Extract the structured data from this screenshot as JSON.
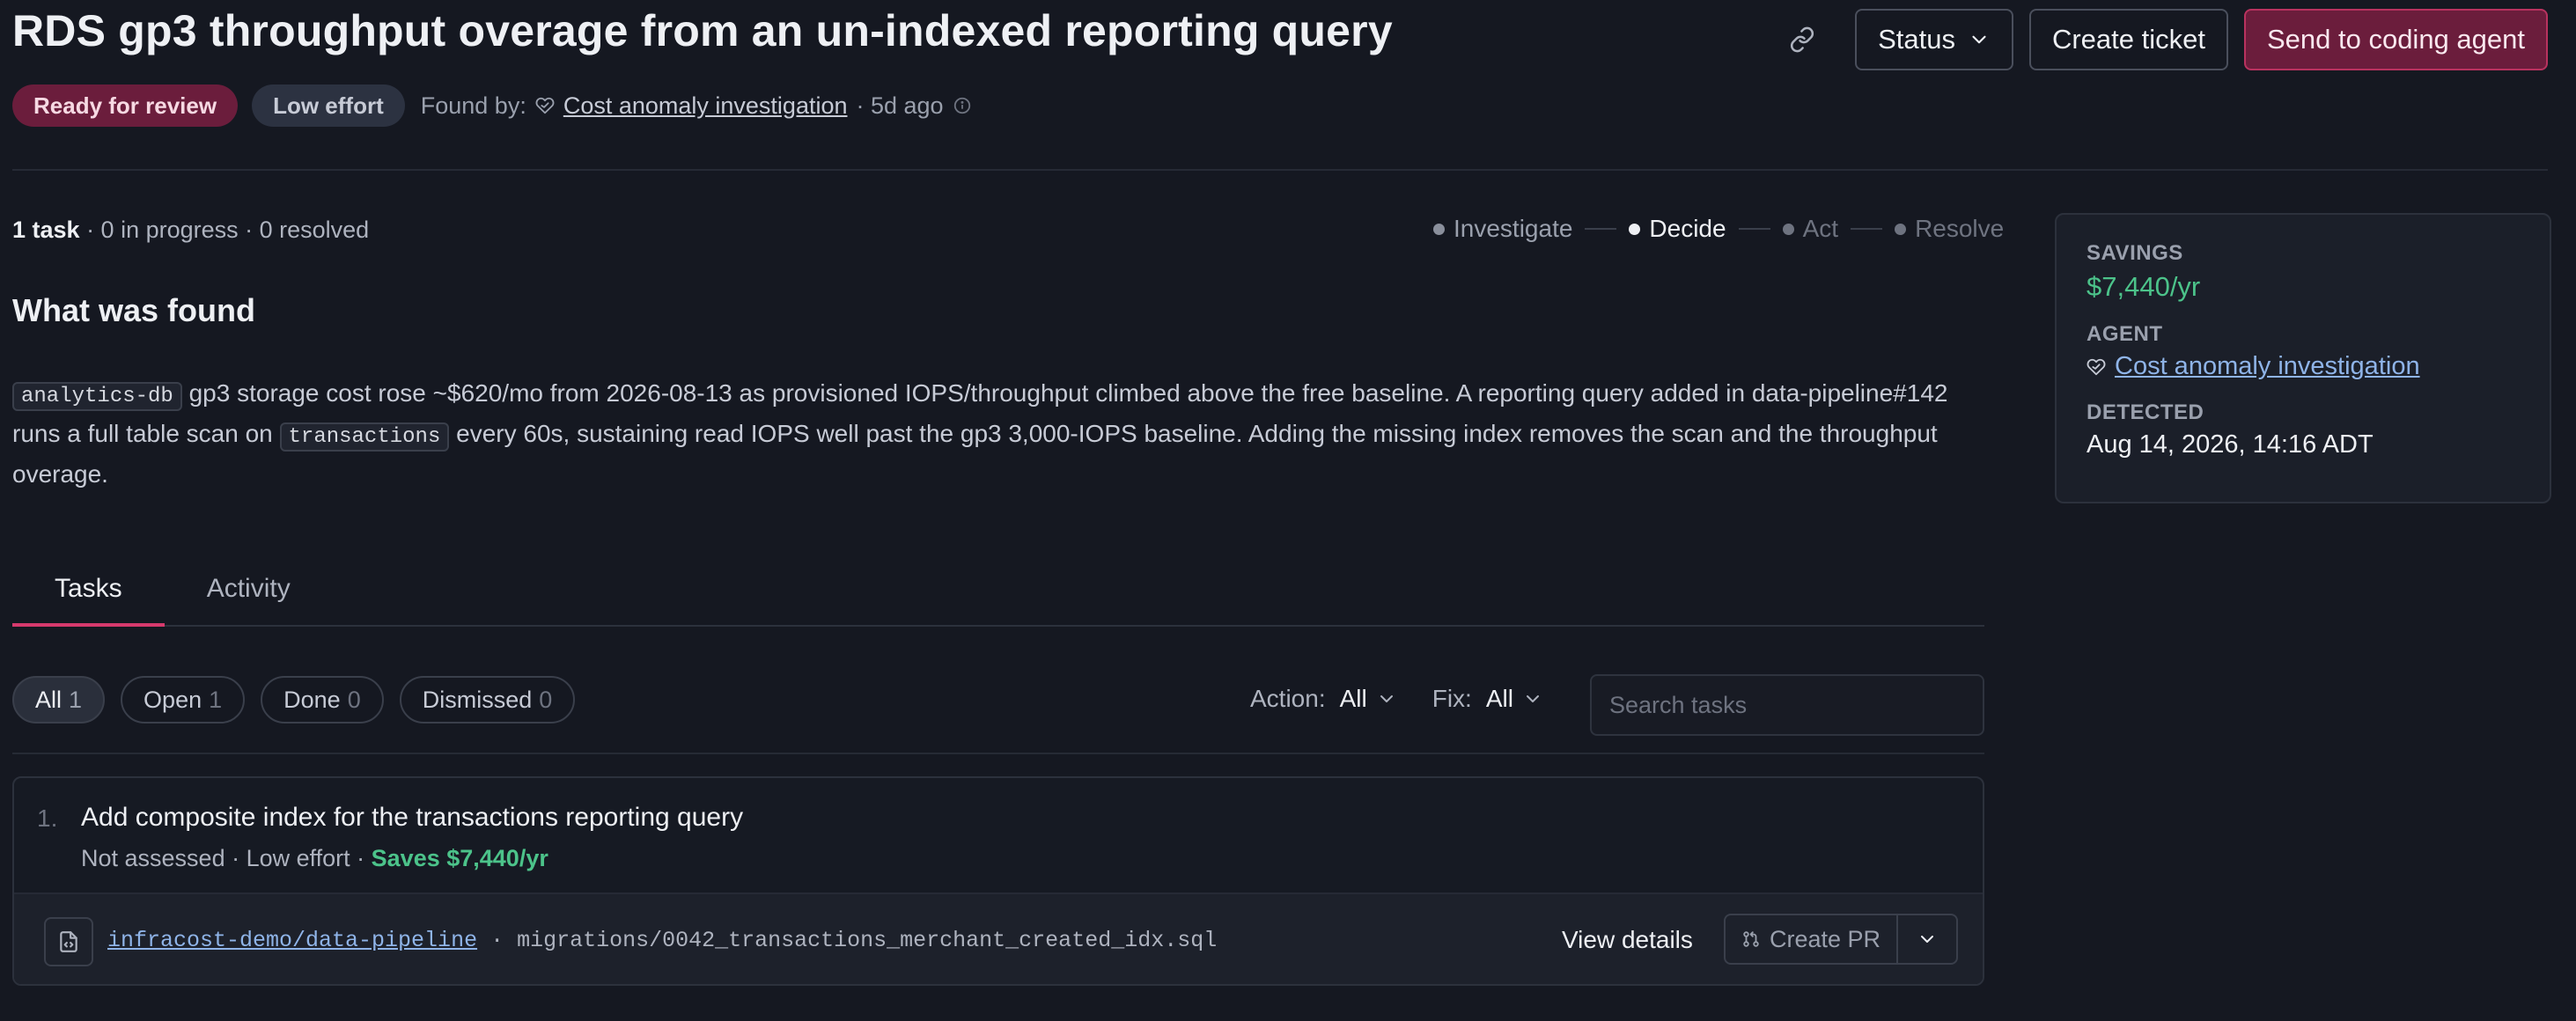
{
  "header": {
    "title": "RDS gp3 throughput overage from an un-indexed reporting query",
    "status_label": "Status",
    "create_ticket_label": "Create ticket",
    "send_agent_label": "Send to coding agent"
  },
  "meta": {
    "status_badge": "Ready for review",
    "effort_badge": "Low effort",
    "found_by_label": "Found by:",
    "found_by_agent": "Cost anomaly investigation",
    "age": "· 5d ago"
  },
  "progress": {
    "task_count": "1 task",
    "rest": " · 0 in progress · 0 resolved",
    "steps": [
      "Investigate",
      "Decide",
      "Act",
      "Resolve"
    ],
    "active_step": "Decide"
  },
  "finding": {
    "title": "What was found",
    "code_db": "analytics-db",
    "text_1": " gp3 storage cost rose ~$620/mo from 2026-08-13 as provisioned IOPS/throughput climbed above the free baseline. A reporting query added in data-pipeline#142 runs a full table scan on ",
    "code_table": "transactions",
    "text_2": " every 60s, sustaining read IOPS well past the gp3 3,000-IOPS baseline. Adding the missing index removes the scan and the throughput overage."
  },
  "tabs": [
    {
      "label": "Tasks",
      "active": true
    },
    {
      "label": "Activity",
      "active": false
    }
  ],
  "filters": {
    "chips": [
      {
        "label": "All",
        "count": "1",
        "active": true
      },
      {
        "label": "Open",
        "count": "1",
        "active": false
      },
      {
        "label": "Done",
        "count": "0",
        "active": false
      },
      {
        "label": "Dismissed",
        "count": "0",
        "active": false
      }
    ],
    "action_label": "Action:",
    "action_value": "All",
    "fix_label": "Fix:",
    "fix_value": "All",
    "search_placeholder": "Search tasks"
  },
  "task": {
    "number": "1.",
    "title": "Add composite index for the transactions reporting query",
    "meta": "Not assessed · Low effort · ",
    "saves": "Saves $7,440/yr",
    "repo": "infracost-demo/data-pipeline",
    "file": " · migrations/0042_transactions_merchant_created_idx.sql",
    "view_details_label": "View details",
    "create_pr_label": "Create PR"
  },
  "sidebar": {
    "savings_label": "SAVINGS",
    "savings_value": "$7,440/yr",
    "agent_label": "AGENT",
    "agent_value": "Cost anomaly investigation",
    "detected_label": "DETECTED",
    "detected_value": "Aug 14, 2026, 14:16 ADT"
  },
  "colors": {
    "accent": "#d63a6d",
    "primary_button": "#6b1d3c",
    "savings_green": "#4cc38a",
    "link_blue": "#8fb4e8",
    "background": "#151821"
  },
  "icons": [
    "link-icon",
    "chevron-down-icon",
    "heart-shield-icon",
    "info-icon",
    "file-code-icon",
    "git-pull-request-icon"
  ]
}
